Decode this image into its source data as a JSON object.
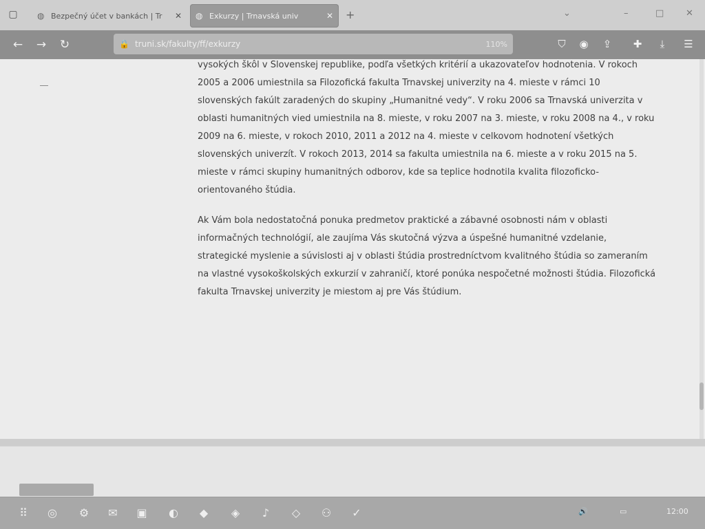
{
  "browser": {
    "tabs": [
      {
        "title": "Bezpečný účet v bankách | Tr",
        "favicon": "globe-icon",
        "active": false
      },
      {
        "title": "Exkurzy | Trnavská univ",
        "favicon": "globe-icon",
        "active": true
      }
    ],
    "new_tab": "+",
    "window_controls": {
      "min": "–",
      "max": "□",
      "close": "✕",
      "tabs_list": "⌄"
    }
  },
  "nav": {
    "back": "←",
    "forward": "→",
    "reload": "↻",
    "url": "truni.sk/fakulty/ff/exkurzy",
    "zoom": "110%",
    "toolbar_icons": [
      "shield-icon",
      "extension-icon",
      "share-icon",
      "puzzle-icon",
      "download-icon",
      "menu-icon"
    ]
  },
  "article": {
    "paragraph1": "vysokých škôl v Slovenskej republike, podľa všetkých kritérií a ukazovateľov hodnotenia. V rokoch 2005 a 2006 umiestnila sa Filozofická fakulta Trnavskej univerzity na 4. mieste v rámci 10 slovenských fakúlt zaradených do skupiny „Humanitné vedy“. V roku 2006 sa Trnavská univerzita v oblasti humanitných vied umiestnila na 8. mieste, v roku 2007 na 3. mieste, v roku 2008 na 4., v roku 2009 na 6. mieste, v rokoch 2010, 2011 a 2012 na 4. mieste v celkovom hodnotení všetkých slovenských univerzít. V rokoch 2013, 2014 sa fakulta umiestnila na 6. mieste a v roku 2015 na 5. mieste v rámci skupiny humanitných odborov, kde sa teplice hodnotila kvalita filozoficko-orientovaného štúdia.",
    "paragraph2": "Ak Vám bola nedostatočná ponuka predmetov praktické a zábavné osobnosti nám v oblasti informačných technológií, ale zaujíma Vás skutočná výzva a úspešné humanitné vzdelanie, strategické myslenie a súvislosti aj v oblasti štúdia prostredníctvom kvalitného štúdia so zameraním na vlastné vysokoškolských exkurzií v zahraničí, ktoré ponúka nespočetné možnosti štúdia. Filozofická fakulta Trnavskej univerzity je miestom aj pre Vás štúdium."
  },
  "taskbar": {
    "apps": [
      "apps-icon",
      "browser-icon",
      "settings-icon",
      "mail-icon",
      "files-icon",
      "terminal-icon",
      "code-icon",
      "chat-icon",
      "music-icon",
      "vpn-icon",
      "network-icon"
    ],
    "tray": {
      "volume": "🔊",
      "battery": "▭",
      "clock": "12:00"
    }
  }
}
